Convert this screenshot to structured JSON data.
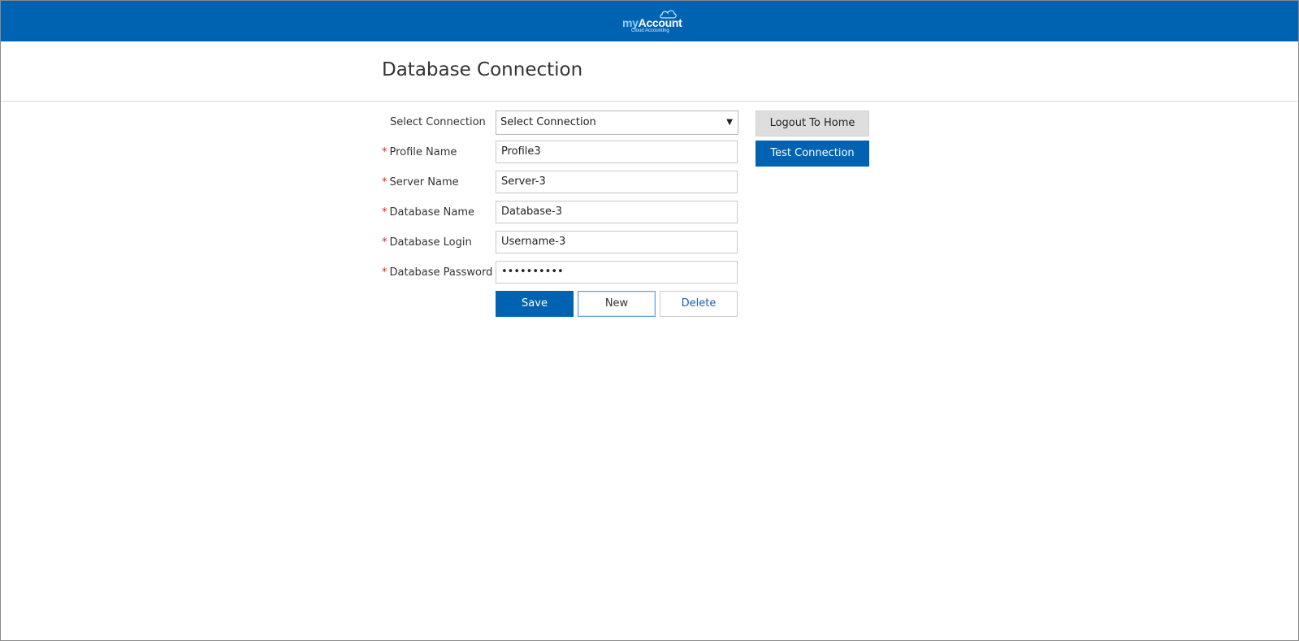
{
  "header": {
    "logo_prefix": "my",
    "logo_main": "Account",
    "logo_sub": "Cloud Accounting",
    "brand_color": "#0063b1"
  },
  "page": {
    "title": "Database Connection"
  },
  "form": {
    "select_connection": {
      "label": "Select Connection",
      "value": "Select Connection",
      "required": false
    },
    "profile_name": {
      "label": "Profile Name",
      "value": "Profile3",
      "required": true
    },
    "server_name": {
      "label": "Server Name",
      "value": "Server-3",
      "required": true
    },
    "database_name": {
      "label": "Database Name",
      "value": "Database-3",
      "required": true
    },
    "database_login": {
      "label": "Database Login",
      "value": "Username-3",
      "required": true
    },
    "database_password": {
      "label": "Database Password",
      "value": "••••••••••",
      "required": true
    },
    "required_marker": "*"
  },
  "actions": {
    "save": "Save",
    "new": "New",
    "delete": "Delete",
    "logout": "Logout To Home",
    "test_connection": "Test Connection"
  },
  "icons": {
    "dropdown": "chevron-down-icon",
    "logo": "cloud-icon"
  }
}
